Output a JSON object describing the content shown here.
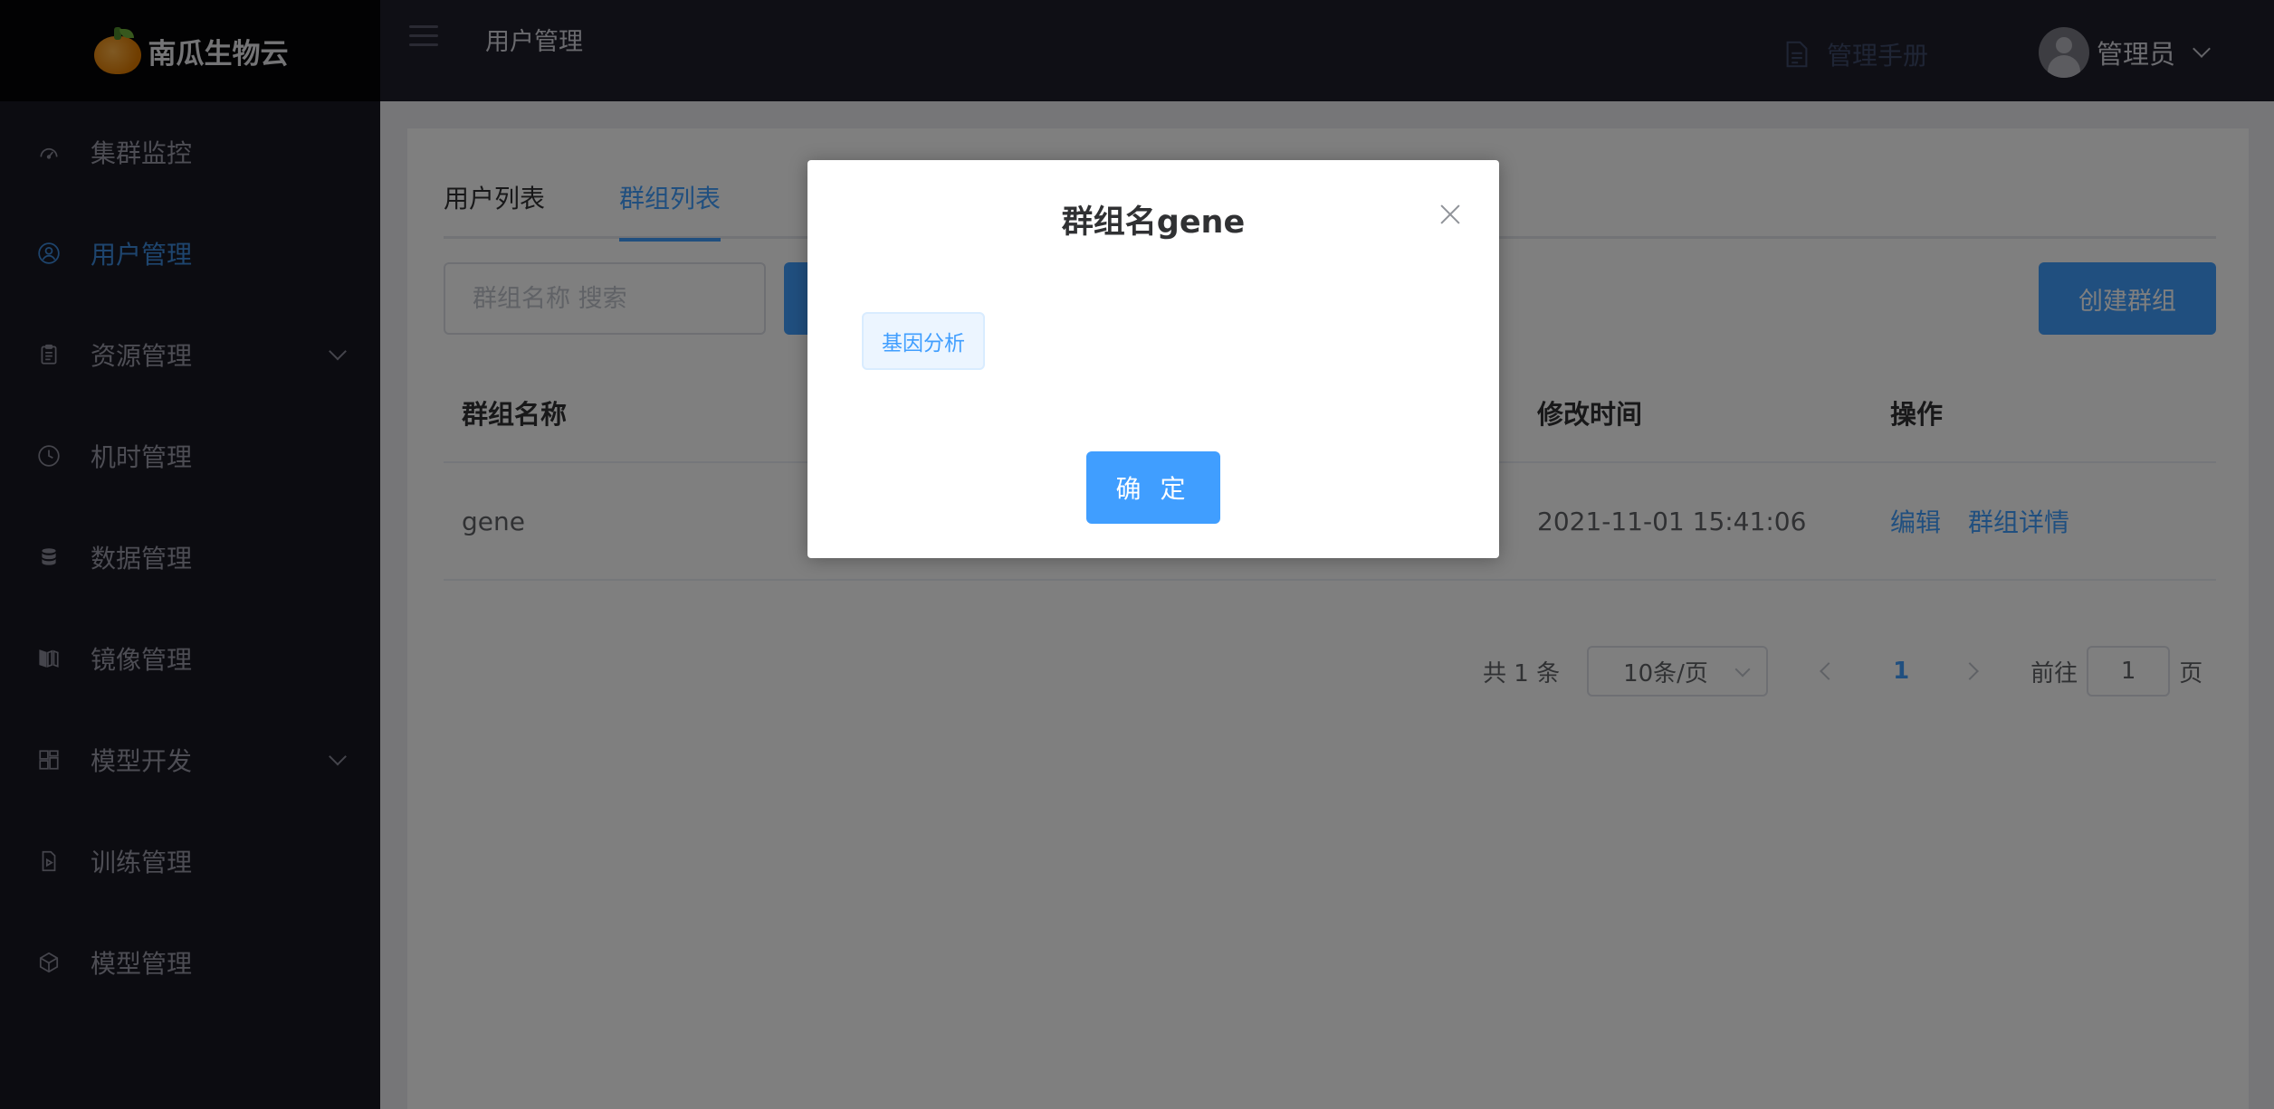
{
  "brand": {
    "name": "南瓜生物云",
    "logo_icon": "pumpkin-logo"
  },
  "sidebar": {
    "items": [
      {
        "label": "集群监控",
        "icon": "dashboard-gauge-icon",
        "active": false,
        "expandable": false
      },
      {
        "label": "用户管理",
        "icon": "user-circle-icon",
        "active": true,
        "expandable": false
      },
      {
        "label": "资源管理",
        "icon": "clipboard-icon",
        "active": false,
        "expandable": true
      },
      {
        "label": "机时管理",
        "icon": "clock-icon",
        "active": false,
        "expandable": false
      },
      {
        "label": "数据管理",
        "icon": "database-icon",
        "active": false,
        "expandable": false
      },
      {
        "label": "镜像管理",
        "icon": "image-layers-icon",
        "active": false,
        "expandable": false
      },
      {
        "label": "模型开发",
        "icon": "grid-blocks-icon",
        "active": false,
        "expandable": true
      },
      {
        "label": "训练管理",
        "icon": "file-play-icon",
        "active": false,
        "expandable": false
      },
      {
        "label": "模型管理",
        "icon": "cube-icon",
        "active": false,
        "expandable": false
      }
    ]
  },
  "header": {
    "title": "用户管理",
    "manual_label": "管理手册",
    "user_name": "管理员"
  },
  "tabs": [
    {
      "label": "用户列表",
      "active": false
    },
    {
      "label": "群组列表",
      "active": true
    }
  ],
  "toolbar": {
    "search_placeholder": "群组名称 搜索",
    "create_label": "创建群组"
  },
  "table": {
    "headers": {
      "name": "群组名称",
      "modified": "修改时间",
      "actions": "操作"
    },
    "rows": [
      {
        "name": "gene",
        "modified": "2021-11-01 15:41:06",
        "edit": "编辑",
        "detail": "群组详情"
      }
    ]
  },
  "pagination": {
    "total_text": "共 1 条",
    "page_size": "10条/页",
    "current_page": "1",
    "goto_label": "前往",
    "goto_value": "1",
    "page_suffix": "页"
  },
  "dialog": {
    "title": "群组名gene",
    "tag": "基因分析",
    "confirm_label": "确 定"
  },
  "colors": {
    "primary": "#409eff",
    "sidebar_bg": "#191923",
    "header_bg": "#1e1e2a"
  }
}
